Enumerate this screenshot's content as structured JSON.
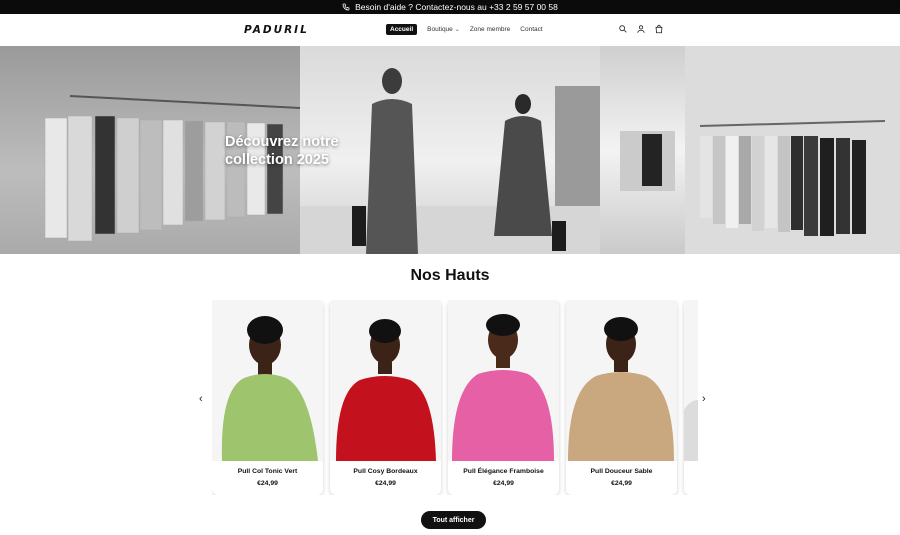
{
  "announcement": {
    "text": "Besoin d'aide ? Contactez-nous au +33 2 59 57 00 58",
    "icon": "phone-icon"
  },
  "header": {
    "logo": "PADURIL",
    "nav": [
      {
        "label": "Accueil",
        "active": true
      },
      {
        "label": "Boutique",
        "has_dropdown": true
      },
      {
        "label": "Zone membre"
      },
      {
        "label": "Contact"
      }
    ],
    "icons": [
      "search-icon",
      "account-icon",
      "cart-icon"
    ]
  },
  "hero": {
    "title": "Découvrez notre collection 2025"
  },
  "section": {
    "title": "Nos Hauts",
    "products": [
      {
        "name": "Pull Col Tonic Vert",
        "price": "€24,99",
        "color": "#9fc46e"
      },
      {
        "name": "Pull Cosy Bordeaux",
        "price": "€24,99",
        "color": "#c3111d"
      },
      {
        "name": "Pull Élégance Framboise",
        "price": "€24,99",
        "color": "#e660a6"
      },
      {
        "name": "Pull Douceur Sable",
        "price": "€24,99",
        "color": "#c9a77f"
      }
    ],
    "button": "Tout afficher"
  },
  "colors": {
    "topbar": "#0b0b0b",
    "accent": "#111111"
  }
}
